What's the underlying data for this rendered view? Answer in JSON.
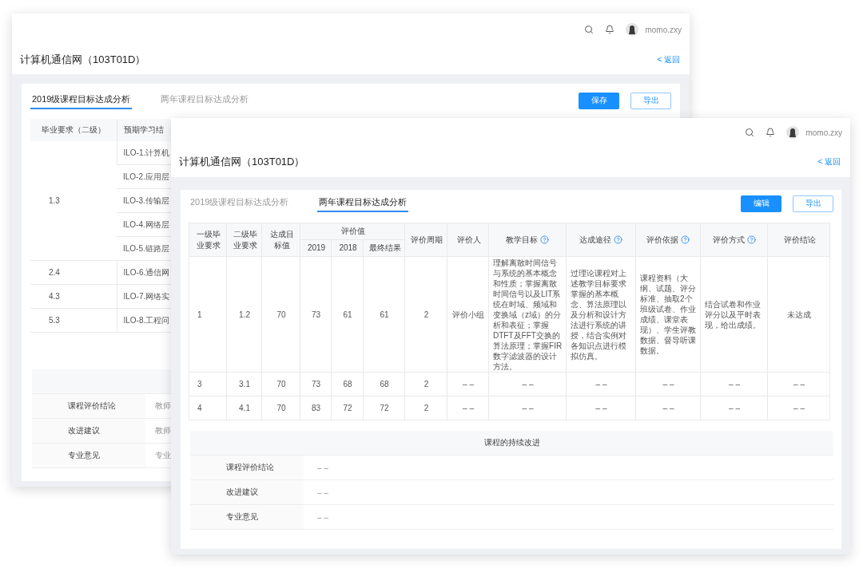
{
  "back_window": {
    "header": {
      "user": "momo.zxy"
    },
    "title": "计算机通信网（103T01D）",
    "back_link": "< 返回",
    "tabs": [
      {
        "label": "2019级课程目标达成分析",
        "selected": true
      },
      {
        "label": "两年课程目标达成分析",
        "selected": false
      }
    ],
    "buttons": [
      {
        "label": "保存",
        "kind": "primary"
      },
      {
        "label": "导出",
        "kind": "outline"
      }
    ],
    "table": {
      "columns": [
        "毕业要求（二级）",
        "预期学习结"
      ],
      "groups": [
        {
          "requirement": "1.3",
          "outcomes": [
            "ILO-1.计算机",
            "ILO-2.应用层",
            "ILO-3.传输层",
            "ILO-4.网络层",
            "ILO-5.链路层"
          ]
        },
        {
          "requirement": "2.4",
          "outcomes": [
            "ILO-6.通信网"
          ]
        },
        {
          "requirement": "4.3",
          "outcomes": [
            "ILO-7.网络实"
          ]
        },
        {
          "requirement": "5.3",
          "outcomes": [
            "ILO-8.工程问"
          ]
        }
      ]
    },
    "improvement": {
      "rows": [
        {
          "label": "课程评价结论",
          "value": "教师"
        },
        {
          "label": "改进建议",
          "value": "教师"
        },
        {
          "label": "专业意见",
          "value": "专业"
        }
      ]
    }
  },
  "front_window": {
    "header": {
      "user": "momo.zxy"
    },
    "title": "计算机通信网（103T01D）",
    "back_link": "< 返回",
    "tabs": [
      {
        "label": "2019级课程目标达成分析",
        "selected": false
      },
      {
        "label": "两年课程目标达成分析",
        "selected": true
      }
    ],
    "buttons": [
      {
        "label": "编辑",
        "kind": "primary"
      },
      {
        "label": "导出",
        "kind": "outline"
      }
    ],
    "table": {
      "header_rows": [
        [
          {
            "label": "一级毕业要求",
            "help": false,
            "rowspan": 2
          },
          {
            "label": "二级毕业要求",
            "help": false,
            "rowspan": 2
          },
          {
            "label": "达成目标值",
            "help": false,
            "rowspan": 2
          },
          {
            "label": "评价值",
            "help": false,
            "colspan": 3
          },
          {
            "label": "评价周期",
            "help": false,
            "rowspan": 2
          },
          {
            "label": "评价人",
            "help": false,
            "rowspan": 2
          },
          {
            "label": "教学目标",
            "help": true,
            "rowspan": 2
          },
          {
            "label": "达成途径",
            "help": true,
            "rowspan": 2
          },
          {
            "label": "评价依据",
            "help": true,
            "rowspan": 2
          },
          {
            "label": "评价方式",
            "help": true,
            "rowspan": 2
          },
          {
            "label": "评价结论",
            "help": false,
            "rowspan": 2
          }
        ],
        [
          {
            "label": "2019",
            "help": false
          },
          {
            "label": "2018",
            "help": false
          },
          {
            "label": "最终结果",
            "help": false
          }
        ]
      ],
      "rows": [
        {
          "cells": [
            "1",
            "1.2",
            "70",
            "73",
            "61",
            "61",
            "2",
            "评价小组",
            "理解离散时间信号与系统的基本概念和性质；掌握离散时间信号以及LIT系统在时域、频域和变换域（z域）的分析和表征；掌握DTFT及FFT交换的算法原理；掌握FIR数字滤波器的设计方法。",
            "过理论课程对上述教学目标要求掌握的基本概念、算法原理以及分析和设计方法进行系统的讲授，结合实例对各知识点进行模拟仿真。",
            "课程资料（大纲、试题、评分标准、抽取2个班级试卷、作业成绩、课堂表现）、学生评教数据、督导听课数据。",
            "结合试卷和作业评分以及平时表现，给出成绩。",
            "未达成"
          ]
        },
        {
          "cells": [
            "3",
            "3.1",
            "70",
            "73",
            "68",
            "68",
            "2",
            "– –",
            "– –",
            "– –",
            "– –",
            "– –",
            "– –"
          ]
        },
        {
          "cells": [
            "4",
            "4.1",
            "70",
            "83",
            "72",
            "72",
            "2",
            "– –",
            "– –",
            "– –",
            "– –",
            "– –",
            "– –"
          ]
        }
      ]
    },
    "improvement": {
      "title": "课程的持续改进",
      "rows": [
        {
          "label": "课程评价结论",
          "value": "– –"
        },
        {
          "label": "改进建议",
          "value": "– –"
        },
        {
          "label": "专业意见",
          "value": "– –"
        }
      ]
    }
  }
}
